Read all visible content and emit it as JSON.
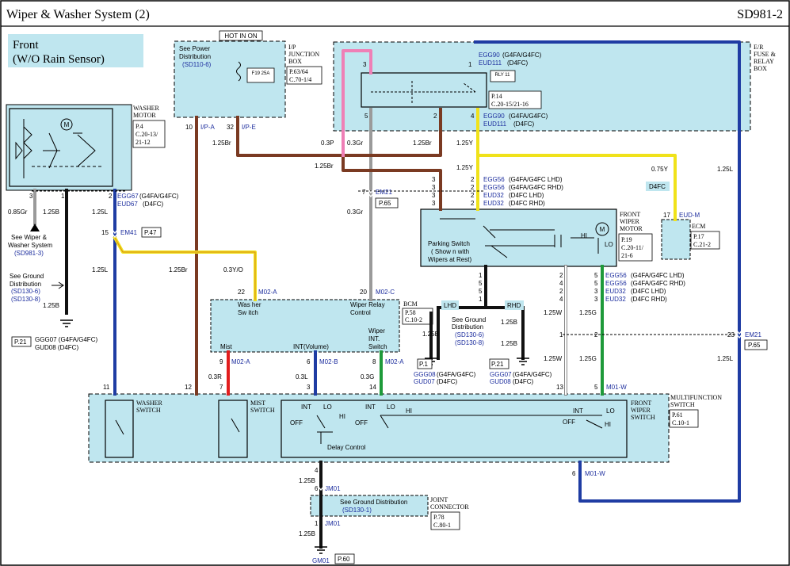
{
  "header": {
    "title": "Wiper & Washer System (2)",
    "code": "SD981-2"
  },
  "variant": {
    "line1": "Front",
    "line2": "(W/O Rain Sensor)"
  },
  "colors": {
    "panel": "#bfe6ef",
    "brown": "#7a3a22",
    "gray": "#9a9a9a",
    "blue": "#1f3ca3",
    "pink": "#ef7fb6",
    "yellow": "#f0e21a",
    "green": "#1e9a3a",
    "red": "#e21d1d",
    "black": "#111111",
    "link": "#1d2e9e"
  },
  "components": {
    "washer_motor": {
      "name1": "WASHER",
      "name2": "MOTOR",
      "ref1": "P.4",
      "ref2": "C.20-13/",
      "ref3": "21-12"
    },
    "ij_box": {
      "hot": "HOT IN ON",
      "see1": "See Power",
      "see2": "Distribution",
      "see3": "(SD110-6)",
      "fuse": "F19 25A",
      "name1": "I/P",
      "name2": "JUNCTION",
      "name3": "BOX",
      "ref1": "P.63/64",
      "ref2": "C.70-1/4"
    },
    "er_box": {
      "name1": "E/R",
      "name2": "FUSE &",
      "name3": "RELAY",
      "name4": "BOX",
      "relay": "RLY 11",
      "ref1": "P.14",
      "ref2": "C.20-15/21-16"
    },
    "front_wiper_motor": {
      "name1": "FRONT",
      "name2": "WIPER",
      "name3": "MOTOR",
      "ref1": "P.19",
      "ref2": "C.20-11/",
      "ref3": "21-6",
      "park1": "Parking Switch",
      "park2": "( Show n with",
      "park3": "Wipers at Rest)",
      "hi": "HI",
      "lo": "LO"
    },
    "ecm": {
      "name": "ECM",
      "ref1": "P.17",
      "ref2": "C.21-2",
      "variant": "D4FC"
    },
    "bcm": {
      "name": "BCM",
      "ref1": "P.58",
      "ref2": "C.10-2",
      "washer1": "Was her",
      "washer2": "Sw itch",
      "relay1": "Wiper Relay",
      "relay2": "Control",
      "mist": "Mist",
      "int": "INT(Volume)",
      "wint1": "Wiper",
      "wint2": "INT.",
      "wint3": "Switch"
    },
    "mfs": {
      "name1": "MULTIFUNCTION",
      "name2": "SWITCH",
      "ref1": "P.61",
      "ref2": "C.10-1",
      "washer1": "WASHER",
      "washer2": "SWITCH",
      "mist1": "MIST",
      "mist2": "SWITCH",
      "front1": "FRONT",
      "front2": "WIPER",
      "front3": "SWITCH",
      "int": "INT",
      "lo": "LO",
      "hi": "HI",
      "off": "OFF",
      "delay": "Delay Control"
    },
    "joint": {
      "name1": "JOINT",
      "name2": "CONNECTOR",
      "ref1": "P.78",
      "ref2": "C.80-1",
      "see": "See Ground Distribution",
      "see_ref": "(SD130-1)"
    }
  },
  "refs": {
    "see_wiper1": "See Wiper &",
    "see_wiper2": "Washer System",
    "see_wiper3": "(SD981-3)",
    "see_ground1": "See Ground",
    "see_ground2": "Distribution",
    "see_ground3": "(SD130-6)",
    "see_ground4": "(SD130-8)",
    "gnd_codes1": "GGG07  (G4FA/G4FC)",
    "gnd_codes2": "GUD08  (D4FC)",
    "p21": "P.21",
    "lhd": "LHD",
    "rhd": "RHD",
    "p1": "P.1",
    "p21b": "P.21",
    "p60": "P.60",
    "lhd_g1": "GGG08",
    "lhd_g1v": "(G4FA/G4FC)",
    "lhd_g2": "GUD07",
    "lhd_g2v": "(D4FC)",
    "rhd_g1": "GGG07",
    "rhd_g1v": "(G4FA/G4FC)",
    "rhd_g2": "GUD08",
    "rhd_g2v": "(D4FC)",
    "gm01": "GM01"
  },
  "connectors": {
    "egg67": "EGG67",
    "egg67v": "(G4FA/G4FC)",
    "eud67": "EUD67",
    "eud67v": "(D4FC)",
    "em41": "EM41",
    "p47": "P.47",
    "ipa": "I/P-A",
    "ipe": "I/P-E",
    "egg90": "EGG90",
    "egg90v": "(G4FA/G4FC)",
    "eud111": "EUD111",
    "eud111v": "(D4FC)",
    "egg90b": "EGG90",
    "egg90bv": "(G4FA/G4FC)",
    "eud111b": "EUD111",
    "eud111bv": "(D4FC)",
    "em21": "EM21",
    "p65": "P.65",
    "egg56a": "EGG56",
    "egg56av": "(G4FA/G4FC LHD)",
    "egg56b": "EGG56",
    "egg56bv": "(G4FA/G4FC RHD)",
    "eud32a": "EUD32",
    "eud32av": "(D4FC LHD)",
    "eud32b": "EUD32",
    "eud32bv": "(D4FC RHD)",
    "eudm": "EUD-M",
    "egg56c": "EGG56",
    "egg56cv": "(G4FA/G4FC LHD)",
    "egg56d": "EGG56",
    "egg56dv": "(G4FA/G4FC RHD)",
    "eud32c": "EUD32",
    "eud32cv": "(D4FC LHD)",
    "eud32d": "EUD32",
    "eud32dv": "(D4FC RHD)",
    "m02a": "M02-A",
    "m02c": "M02-C",
    "m02a2": "M02-A",
    "m02b": "M02-B",
    "m02a3": "M02-A",
    "m01w": "M01-W",
    "m01w2": "M01-W",
    "em21b": "EM21",
    "p65b": "P.65",
    "jm01": "JM01",
    "jm01b": "JM01"
  },
  "pins": {
    "wm3": "3",
    "wm1": "1",
    "wm2": "2",
    "em41_15": "15",
    "ij10": "10",
    "ij32": "32",
    "er3": "3",
    "er1": "1",
    "er5": "5",
    "er2": "2",
    "er4": "4",
    "em21_7": "7",
    "m3a": "3",
    "m3b": "3",
    "m3c": "3",
    "m3d": "3",
    "m2a": "2",
    "m2b": "2",
    "m2c": "2",
    "m2d": "2",
    "ecm17": "17",
    "b22": "22",
    "b20": "20",
    "b9": "9",
    "b6": "6",
    "b8": "8",
    "g1a": "1",
    "g5a": "5",
    "g5b": "5",
    "g1b": "1",
    "w2": "2",
    "w4": "4",
    "w2b": "2",
    "w4b": "4",
    "r5": "5",
    "r5b": "5",
    "r3": "3",
    "r3b": "3",
    "em21_1": "1",
    "em21_2": "2",
    "em21_23": "23",
    "s11": "11",
    "s12": "12",
    "s7": "7",
    "s3": "3",
    "s14": "14",
    "s13": "13",
    "s5": "5",
    "s4": "4",
    "s6": "6",
    "j6": "6",
    "j1": "1"
  },
  "wires": {
    "w085gr": "0.85Gr",
    "w125b": "1.25B",
    "w125l": "1.25L",
    "w125l2": "1.25L",
    "w125br": "1.25Br",
    "w03p": "0.3P",
    "w03gr": "0.3Gr",
    "w125br2": "1.25Br",
    "w125y": "1.25Y",
    "w125br3": "1.25Br",
    "w125y2": "1.25Y",
    "w075y": "0.75Y",
    "w125l3": "1.25L",
    "w03gr2": "0.3Gr",
    "w03yo": "0.3Y/O",
    "w125b2": "1.25B",
    "w125w": "1.25W",
    "w125g": "1.25G",
    "w125b3": "1.25B",
    "w125b4": "1.25B",
    "w125w2": "1.25W",
    "w125g2": "1.25G",
    "w125l4": "1.25L",
    "w03r": "0.3R",
    "w03l": "0.3L",
    "w03g": "0.3G",
    "w125b5": "1.25B",
    "w125b6": "1.25B"
  }
}
